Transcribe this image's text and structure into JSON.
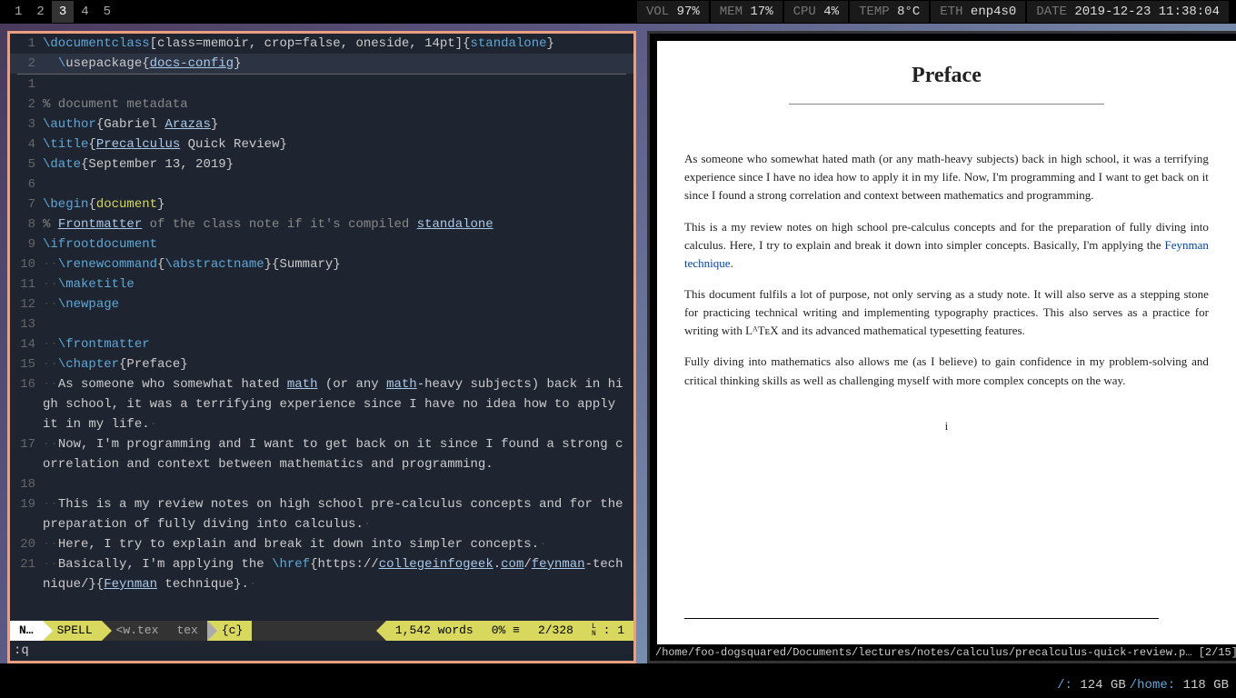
{
  "topbar": {
    "workspaces": [
      "1",
      "2",
      "3",
      "4",
      "5"
    ],
    "active_workspace": 2,
    "vol": {
      "label": "VOL",
      "value": "97%"
    },
    "mem": {
      "label": "MEM",
      "value": "17%"
    },
    "cpu": {
      "label": "CPU",
      "value": "4%"
    },
    "temp": {
      "label": "TEMP",
      "value": "8°C"
    },
    "eth": {
      "label": "ETH",
      "value": "enp4s0"
    },
    "date": {
      "label": "DATE",
      "value": "2019-12-23 11:38:04"
    }
  },
  "editor": {
    "header": {
      "num": "1",
      "code_html": "<span class='tex-cmd'>\\documentclass</span>[class=memoir, crop=false, oneside, 14pt]{<span class='tex-cmd'>standalone</span>}"
    },
    "subheader": {
      "num": "2",
      "code_html": "  <span class='tex-cmd'>\\</span>usepackage{<span class='tex-underline'>docs-config</span>}"
    },
    "lines": [
      {
        "num": "1",
        "code_html": ""
      },
      {
        "num": "2",
        "code_html": "<span class='tex-comment'>% document metadata</span>"
      },
      {
        "num": "3",
        "code_html": "<span class='tex-cmd'>\\author</span>{Gabriel <span class='tex-underline'>Arazas</span>}"
      },
      {
        "num": "4",
        "code_html": "<span class='tex-cmd'>\\title</span>{<span class='tex-underline'>Precalculus</span> Quick Review}"
      },
      {
        "num": "5",
        "code_html": "<span class='tex-cmd'>\\date</span>{September 13, 2019}"
      },
      {
        "num": "6",
        "code_html": ""
      },
      {
        "num": "7",
        "code_html": "<span class='tex-cmd'>\\begin</span>{<span class='tex-env'>document</span>}"
      },
      {
        "num": "8",
        "code_html": "<span class='tex-comment'>% </span><span class='tex-underline'>Frontmatter</span><span class='tex-comment'> of the class note if it's compiled </span><span class='tex-underline'>standalone</span>"
      },
      {
        "num": "9",
        "code_html": "<span class='tex-cmd'>\\ifrootdocument</span>"
      },
      {
        "num": "10",
        "code_html": "<span class='dots'>··</span><span class='tex-cmd'>\\renewcommand</span>{<span class='tex-cmd'>\\abstractname</span>}{Summary}"
      },
      {
        "num": "11",
        "code_html": "<span class='dots'>··</span><span class='tex-cmd'>\\maketitle</span>"
      },
      {
        "num": "12",
        "code_html": "<span class='dots'>··</span><span class='tex-cmd'>\\newpage</span>"
      },
      {
        "num": "13",
        "code_html": ""
      },
      {
        "num": "14",
        "code_html": "<span class='dots'>··</span><span class='tex-cmd'>\\frontmatter</span>"
      },
      {
        "num": "15",
        "code_html": "<span class='dots'>··</span><span class='tex-cmd'>\\chapter</span>{Preface}"
      },
      {
        "num": "16",
        "code_html": "<span class='dots'>··</span>As someone who somewhat hated <span class='tex-underline'>math</span> (or any <span class='tex-underline'>math</span>-heavy subjects) back in high school, it was a terrifying experience since I have no idea how to apply it in my life.<span class='dots'>·</span>"
      },
      {
        "num": "17",
        "code_html": "<span class='dots'>··</span>Now, I'm programming and I want to get back on it since I found a strong correlation and context between mathematics and programming."
      },
      {
        "num": "18",
        "code_html": ""
      },
      {
        "num": "19",
        "code_html": "<span class='dots'>··</span>This is a my review notes on high school pre-calculus concepts and for the preparation of fully diving into calculus.<span class='dots'>·</span>"
      },
      {
        "num": "20",
        "code_html": "<span class='dots'>··</span>Here, I try to explain and break it down into simpler concepts.<span class='dots'>·</span>"
      },
      {
        "num": "21",
        "code_html": "<span class='dots'>··</span>Basically, I'm applying the <span class='tex-cmd'>\\href</span>{https://<span class='tex-url'>collegeinfogeek</span>.<span class='tex-url'>com</span>/<span class='tex-url'>feynman</span>-technique/}{<span class='tex-underline'>Feynman</span> technique}.<span class='dots'>·</span>"
      }
    ],
    "statusline": {
      "mode": "N…",
      "spell": "SPELL",
      "filename": "<w.tex",
      "filetype": "tex",
      "encoding": "{c}",
      "words": "1,542 words",
      "percent": "0% ≡",
      "position": "2/328",
      "ln_indicator": "L\nN",
      "col": ": 1"
    },
    "cmdline": ":q"
  },
  "pdf": {
    "title": "Preface",
    "para1": "As someone who somewhat hated math (or any math-heavy subjects) back in high school, it was a terrifying experience since I have no idea how to apply it in my life. Now, I'm programming and I want to get back on it since I found a strong correlation and context between mathematics and programming.",
    "para2_pre": "This is a my review notes on high school pre-calculus concepts and for the preparation of fully diving into calculus. Here, I try to explain and break it down into simpler concepts. Basically, I'm applying the ",
    "para2_link": "Feynman technique",
    "para2_post": ".",
    "para3": "This document fulfils a lot of purpose, not only serving as a study note. It will also serve as a stepping stone for practicing technical writing and implementing typography practices. This also serves as a practice for writing with LᴬTᴇX and its advanced mathematical typesetting features.",
    "para4": "Fully diving into mathematics also allows me (as I believe) to gain confidence in my problem-solving and critical thinking skills as well as challenging myself with more complex concepts on the way.",
    "pagenum": "i",
    "statuspath": "/home/foo-dogsquared/Documents/lectures/notes/calculus/precalculus-quick-review.p… [2/15]"
  },
  "bottombar": {
    "disk1": {
      "path": "/:",
      "value": "124 GB"
    },
    "disk2": {
      "path": "/home:",
      "value": "118 GB"
    }
  }
}
